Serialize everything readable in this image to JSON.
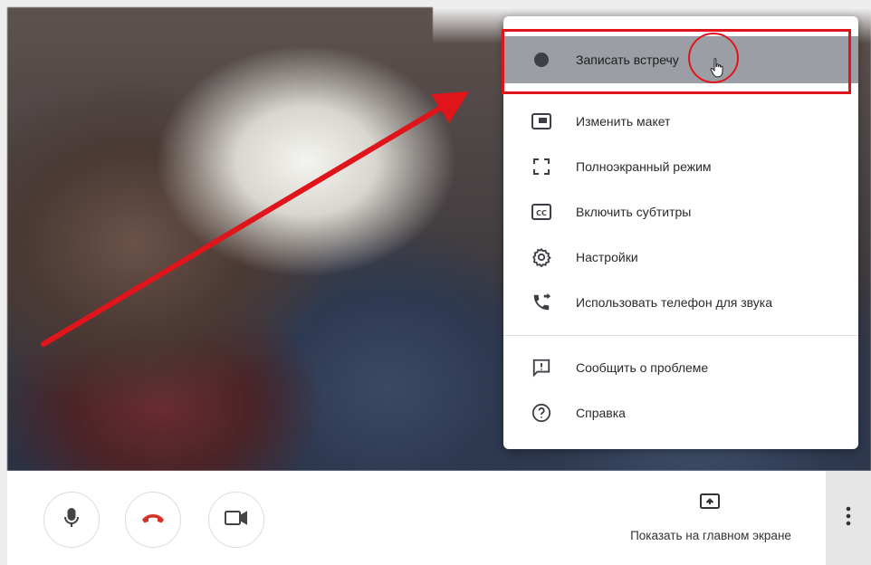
{
  "menu": {
    "items": [
      {
        "label": "Записать встречу",
        "icon": "record-dot-icon",
        "highlighted": true
      },
      {
        "label": "Изменить макет",
        "icon": "layout-icon"
      },
      {
        "label": "Полноэкранный режим",
        "icon": "fullscreen-icon"
      },
      {
        "label": "Включить субтитры",
        "icon": "captions-icon"
      },
      {
        "label": "Настройки",
        "icon": "gear-icon"
      },
      {
        "label": "Использовать телефон для звука",
        "icon": "phone-audio-icon"
      },
      {
        "label": "Сообщить о проблеме",
        "icon": "report-problem-icon"
      },
      {
        "label": "Справка",
        "icon": "help-icon"
      }
    ],
    "captions_icon_text": "CC"
  },
  "controls": {
    "mic_icon": "microphone-icon",
    "hangup_icon": "hang-up-icon",
    "camera_icon": "camera-icon",
    "present_label": "Показать на главном экране",
    "present_icon": "present-screen-icon",
    "more_icon": "more-vertical-icon"
  },
  "colors": {
    "annotation_red": "#e0151b",
    "hangup_red": "#d93025",
    "highlight_gray": "#9b9ea4"
  }
}
